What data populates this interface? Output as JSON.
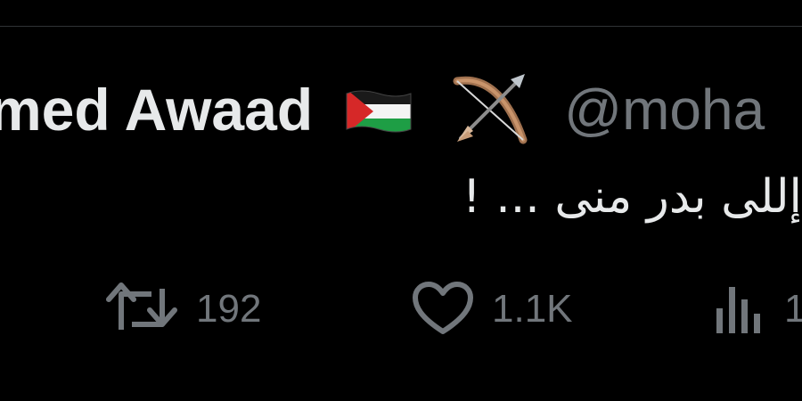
{
  "tweet": {
    "display_name": "med Awaad",
    "handle": "@moha",
    "text": "إللى بدر منى ... !",
    "flag_icon": "palestine-flag-emoji",
    "bow_icon": "bow-and-arrow-emoji"
  },
  "actions": {
    "retweet": {
      "icon": "retweet-icon",
      "count": "192"
    },
    "like": {
      "icon": "heart-icon",
      "count": "1.1K"
    },
    "views": {
      "icon": "views-bar-chart-icon",
      "count": "1"
    }
  },
  "colors": {
    "background": "#000000",
    "primary_text": "#e7e9ea",
    "secondary_text": "#71767b",
    "divider": "#2f3336"
  }
}
